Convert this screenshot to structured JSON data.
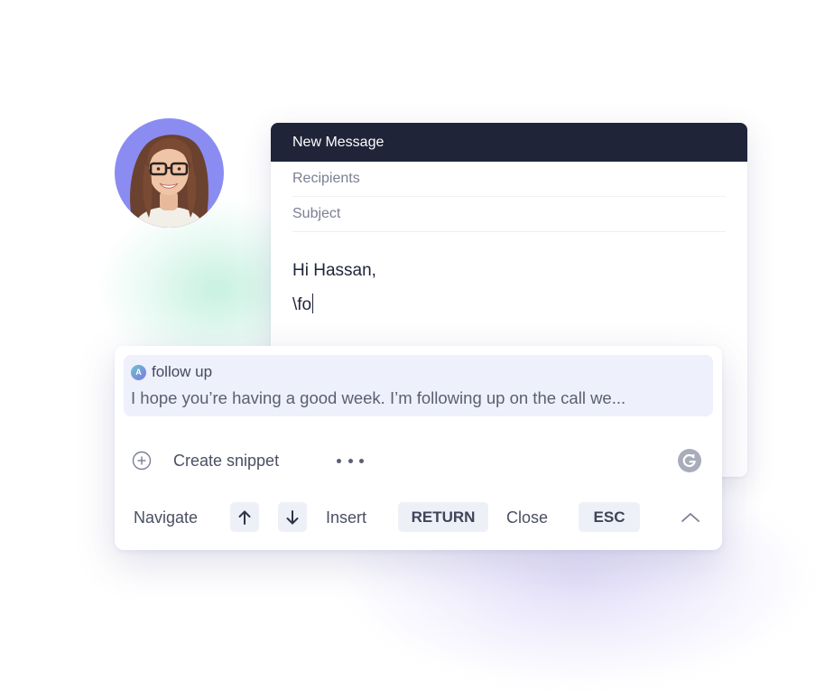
{
  "compose": {
    "title": "New Message",
    "recipients_placeholder": "Recipients",
    "subject_placeholder": "Subject",
    "body_lines": [
      "Hi Hassan,",
      "\\fo"
    ]
  },
  "suggestion": {
    "badge_letter": "A",
    "title": "follow up",
    "preview": "I hope you’re having a good week. I’m following up on the call we..."
  },
  "actions": {
    "create_snippet": "Create snippet"
  },
  "shortcuts": {
    "navigate_label": "Navigate",
    "insert_label": "Insert",
    "insert_key": "RETURN",
    "close_label": "Close",
    "close_key": "ESC"
  },
  "icons": {
    "up": "arrow-up-icon",
    "down": "arrow-down-icon",
    "add": "plus-circle-icon",
    "more": "more-horizontal-icon",
    "grammarly": "grammarly-icon",
    "collapse": "chevron-up-icon"
  },
  "colors": {
    "header_bg": "#1f2439",
    "avatar_bg": "#8b8cf2",
    "suggestion_bg": "#eef0fb",
    "key_bg": "#eef0f7"
  }
}
